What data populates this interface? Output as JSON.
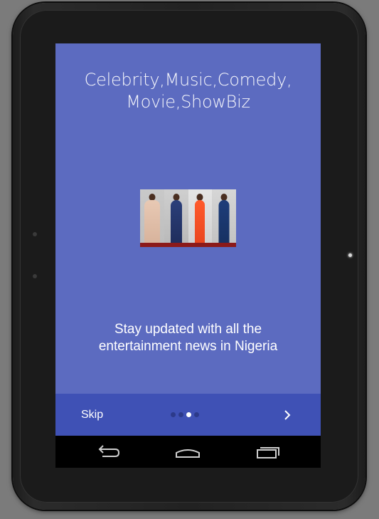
{
  "onboarding": {
    "headline_line1": "Celebrity,Music,Comedy,",
    "headline_line2": "Movie,ShowBiz",
    "image_alt": "celebrity-photo",
    "subtitle": "Stay updated with all the entertainment news in Nigeria"
  },
  "bottom_bar": {
    "skip_label": "Skip",
    "page_count": 4,
    "active_page": 3,
    "next_icon": "chevron-right-icon"
  },
  "nav_bar": {
    "back_icon": "back-icon",
    "home_icon": "home-icon",
    "recents_icon": "recents-icon"
  },
  "colors": {
    "screen_background": "#5c6bc0",
    "bottom_bar": "#3f51b5",
    "indicator_inactive": "#2c3a8a",
    "indicator_active": "#ffffff"
  }
}
